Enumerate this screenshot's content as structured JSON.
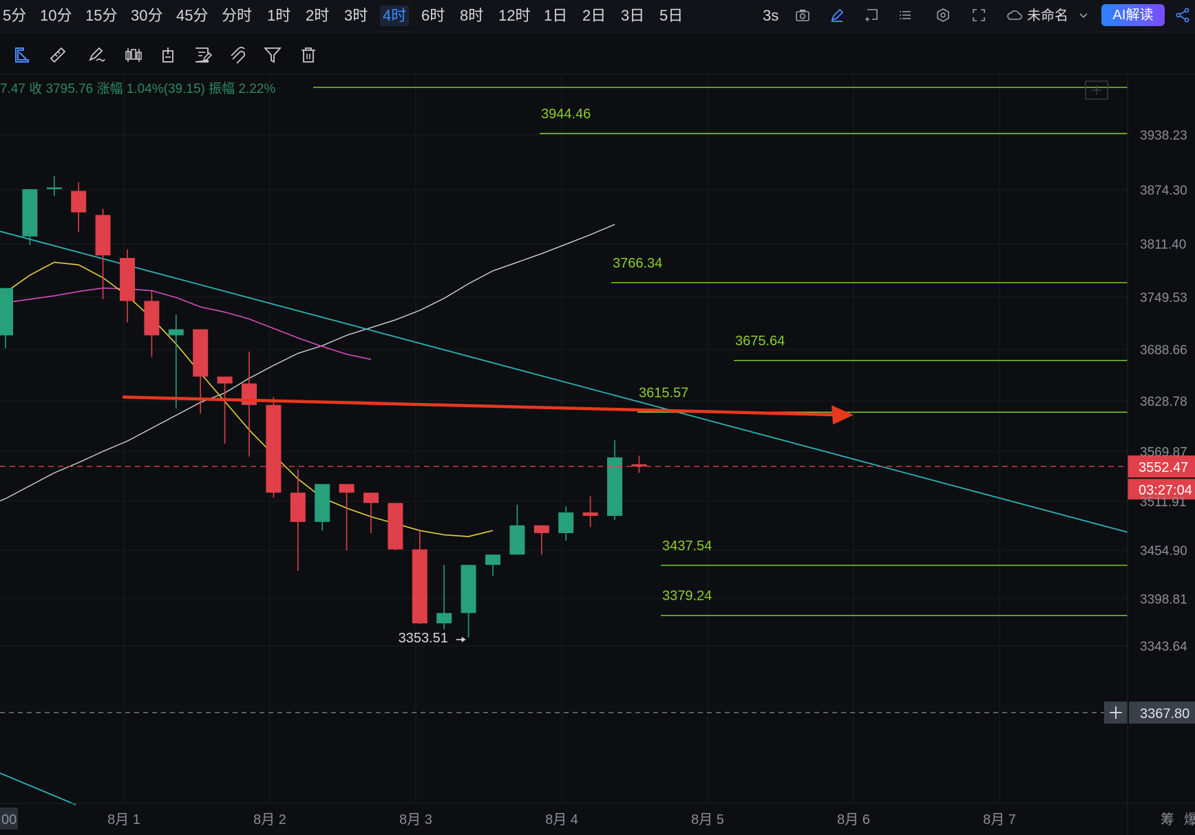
{
  "intervals": [
    "5分",
    "10分",
    "15分",
    "30分",
    "45分",
    "分时",
    "1时",
    "2时",
    "3时",
    "4时",
    "6时",
    "8时",
    "12时",
    "1日",
    "2日",
    "3日",
    "5日"
  ],
  "active_interval": "4时",
  "toolbar": {
    "refresh": "3s",
    "layout_name": "未命名",
    "ai_button": "AI解读"
  },
  "ohlc_text": "7.47 收 3795.76 涨幅 1.04%(39.15) 振幅 2.22%",
  "colors": {
    "up": "#26a17b",
    "down": "#e0404a",
    "level": "#7ec82a",
    "accent": "#3d8bff",
    "trend": "#2bb5b8",
    "ma_yellow": "#e6d23a",
    "ma_pink": "#d64ec0",
    "ma_white": "#cfd2d8",
    "arrow": "#e8391f"
  },
  "price_axis": [
    "3938.23",
    "3874.30",
    "3811.40",
    "3749.53",
    "3688.66",
    "3628.78",
    "3569.87",
    "3511.91",
    "3454.90",
    "3398.81",
    "3343.64"
  ],
  "current_price": "3552.47",
  "countdown": "03:27:04",
  "crosshair_price": "3367.80",
  "date_axis": [
    "00",
    "8月 1",
    "8月 2",
    "8月 3",
    "8月 4",
    "8月 5",
    "8月 6",
    "8月 7"
  ],
  "bottom_right": [
    "筹",
    "爆"
  ],
  "levels": [
    "3944.46",
    "3766.34",
    "3675.64",
    "3615.57",
    "3437.54",
    "3379.24"
  ],
  "low_marker": "3353.51",
  "chart_data": {
    "type": "candlestick",
    "interval": "4时",
    "candles": [
      {
        "o": 3705,
        "h": 3760,
        "l": 3690,
        "c": 3760
      },
      {
        "o": 3820,
        "h": 3875,
        "l": 3810,
        "c": 3875
      },
      {
        "o": 3875,
        "h": 3890,
        "l": 3867,
        "c": 3877
      },
      {
        "o": 3873,
        "h": 3883,
        "l": 3825,
        "c": 3848
      },
      {
        "o": 3845,
        "h": 3852,
        "l": 3747,
        "c": 3798
      },
      {
        "o": 3795,
        "h": 3805,
        "l": 3720,
        "c": 3745
      },
      {
        "o": 3745,
        "h": 3757,
        "l": 3680,
        "c": 3705
      },
      {
        "o": 3705,
        "h": 3729,
        "l": 3620,
        "c": 3712
      },
      {
        "o": 3712,
        "h": 3712,
        "l": 3614,
        "c": 3657
      },
      {
        "o": 3657,
        "h": 3657,
        "l": 3579,
        "c": 3649
      },
      {
        "o": 3649,
        "h": 3686,
        "l": 3564,
        "c": 3624
      },
      {
        "o": 3624,
        "h": 3633,
        "l": 3516,
        "c": 3522
      },
      {
        "o": 3522,
        "h": 3549,
        "l": 3431,
        "c": 3488
      },
      {
        "o": 3488,
        "h": 3532,
        "l": 3478,
        "c": 3532
      },
      {
        "o": 3532,
        "h": 3532,
        "l": 3455,
        "c": 3522
      },
      {
        "o": 3522,
        "h": 3522,
        "l": 3475,
        "c": 3510
      },
      {
        "o": 3510,
        "h": 3510,
        "l": 3455,
        "c": 3456
      },
      {
        "o": 3456,
        "h": 3478,
        "l": 3369,
        "c": 3370
      },
      {
        "o": 3370,
        "h": 3438,
        "l": 3363,
        "c": 3382
      },
      {
        "o": 3382,
        "h": 3392,
        "l": 3353.51,
        "c": 3438
      },
      {
        "o": 3438,
        "h": 3448,
        "l": 3425,
        "c": 3450
      },
      {
        "o": 3450,
        "h": 3508,
        "l": 3450,
        "c": 3484
      },
      {
        "o": 3484,
        "h": 3484,
        "l": 3450,
        "c": 3475
      },
      {
        "o": 3475,
        "h": 3506,
        "l": 3466,
        "c": 3499
      },
      {
        "o": 3499,
        "h": 3518,
        "l": 3482,
        "c": 3495
      },
      {
        "o": 3495,
        "h": 3583,
        "l": 3490,
        "c": 3563
      },
      {
        "o": 3555,
        "h": 3565,
        "l": 3545,
        "c": 3552.47
      }
    ],
    "ma_yellow": [
      3755,
      3775,
      3790,
      3787,
      3772,
      3751,
      3725,
      3695,
      3661,
      3628,
      3595,
      3566,
      3538,
      3516,
      3504,
      3494,
      3486,
      3478,
      3473,
      3471,
      3478
    ],
    "ma_pink": [
      3738,
      3743,
      3747,
      3751,
      3756,
      3760,
      3759,
      3757,
      3749,
      3738,
      3732,
      3724,
      3713,
      3702,
      3692,
      3683,
      3677
    ],
    "ma_white": [
      3504,
      3515,
      3530,
      3545,
      3557,
      3570,
      3582,
      3597,
      3612,
      3627,
      3638,
      3655,
      3670,
      3684,
      3693,
      3705,
      3714,
      3723,
      3734,
      3748,
      3765,
      3780,
      3790,
      3800,
      3811,
      3822,
      3834
    ],
    "horizontal_levels": [
      3944.46,
      3766.34,
      3675.64,
      3615.57,
      3437.54,
      3379.24
    ],
    "trendline": {
      "from_price": 3826,
      "to_price": 3476
    },
    "arrow_price": 3622,
    "low": 3353.51,
    "last": 3552.47
  }
}
